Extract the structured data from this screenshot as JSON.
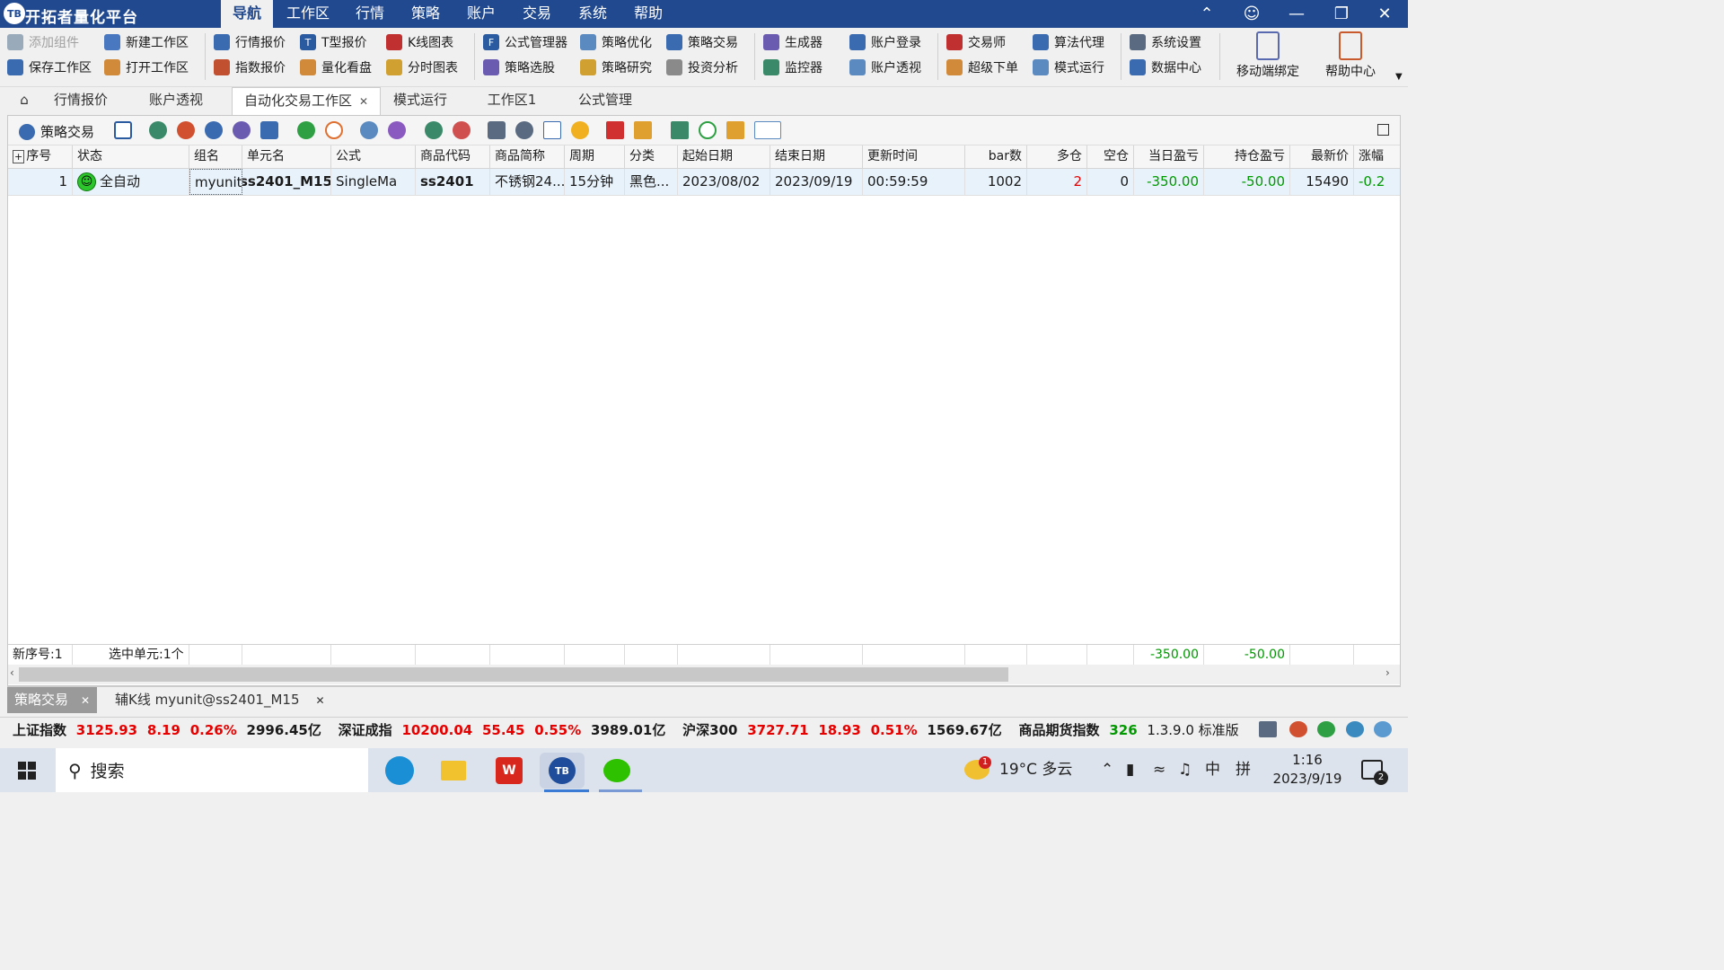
{
  "app": {
    "logo": "TB",
    "title": "开拓者量化平台"
  },
  "menu": [
    "导航",
    "工作区",
    "行情",
    "策略",
    "账户",
    "交易",
    "系统",
    "帮助"
  ],
  "ribbon": {
    "col1": [
      "添加组件",
      "保存工作区"
    ],
    "col2": [
      "新建工作区",
      "打开工作区"
    ],
    "col3": [
      "行情报价",
      "指数报价"
    ],
    "col4": [
      "T型报价",
      "量化看盘"
    ],
    "col5": [
      "K线图表",
      "分时图表"
    ],
    "col6": [
      "公式管理器",
      "策略选股"
    ],
    "col7": [
      "策略优化",
      "策略研究"
    ],
    "col8": [
      "策略交易",
      "投资分析"
    ],
    "col9": [
      "生成器",
      "监控器"
    ],
    "col10": [
      "账户登录",
      "账户透视"
    ],
    "col11": [
      "交易师",
      "超级下单"
    ],
    "col12": [
      "算法代理",
      "模式运行"
    ],
    "col13": [
      "系统设置",
      "数据中心"
    ],
    "big": [
      "移动端绑定",
      "帮助中心"
    ]
  },
  "tabs": [
    "行情报价",
    "账户透视",
    "自动化交易工作区",
    "模式运行",
    "工作区1",
    "公式管理"
  ],
  "panel": {
    "toolbar_label": "策略交易",
    "headers": [
      "序号",
      "状态",
      "组名",
      "单元名",
      "公式",
      "商品代码",
      "商品简称",
      "周期",
      "分类",
      "起始日期",
      "结束日期",
      "更新时间",
      "bar数",
      "多仓",
      "空仓",
      "当日盈亏",
      "持仓盈亏",
      "最新价",
      "涨幅"
    ],
    "row": {
      "idx": "1",
      "status": "全自动",
      "group": "myunit",
      "unit": "ss2401_M15",
      "unit_suffix": "1",
      "formula": "SingleMa",
      "code": "ss2401",
      "name": "不锈钢24...",
      "period": "15分钟",
      "category": "黑色...",
      "start": "2023/08/02",
      "end": "2023/09/19",
      "update": "00:59:59",
      "bars": "1002",
      "long": "2",
      "short": "0",
      "day_pnl": "-350.00",
      "pos_pnl": "-50.00",
      "last": "15490",
      "change": "-0.2"
    },
    "footer": {
      "new_idx": "新序号:1",
      "selected": "选中单元:1个",
      "day_pnl": "-350.00",
      "pos_pnl": "-50.00"
    }
  },
  "bottom_tabs": [
    "策略交易",
    "辅K线 myunit@ss2401_M15"
  ],
  "ticker": {
    "sh_label": "上证指数",
    "sh_val": "3125.93",
    "sh_chg": "8.19",
    "sh_pct": "0.26%",
    "sh_amt": "2996.45亿",
    "sz_label": "深证成指",
    "sz_val": "10200.04",
    "sz_chg": "55.45",
    "sz_pct": "0.55%",
    "sz_amt": "3989.01亿",
    "hs_label": "沪深300",
    "hs_val": "3727.71",
    "hs_chg": "18.93",
    "hs_pct": "0.51%",
    "hs_amt": "1569.67亿",
    "cf_label": "商品期货指数",
    "cf_val": "326",
    "version": "1.3.9.0 标准版"
  },
  "taskbar": {
    "search": "搜索",
    "weather": "19°C 多云",
    "weather_badge": "1",
    "ime1": "中",
    "ime2": "拼",
    "time": "1:16",
    "date": "2023/9/19",
    "notif": "2"
  }
}
